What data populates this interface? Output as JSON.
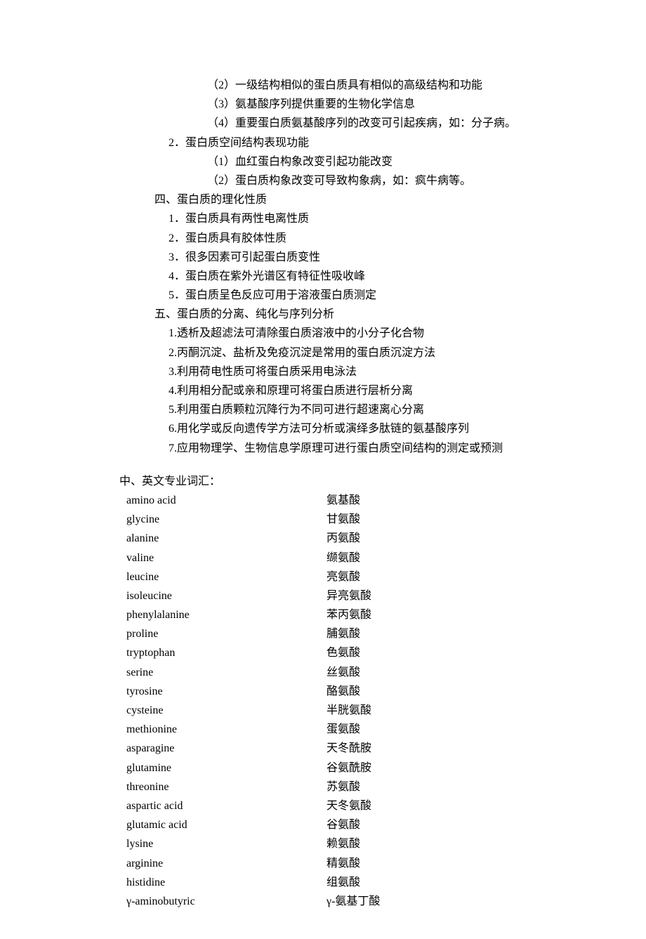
{
  "outline": {
    "l3_items": [
      "（2）一级结构相似的蛋白质具有相似的高级结构和功能",
      "（3）氨基酸序列提供重要的生物化学信息",
      "（4）重要蛋白质氨基酸序列的改变可引起疾病，如：分子病。"
    ],
    "sec2_title": "2．蛋白质空间结构表现功能",
    "sec2_items": [
      "（1）血红蛋白构象改变引起功能改变",
      "（2）蛋白质构象改变可导致构象病，如：疯牛病等。"
    ],
    "section4_title": "四、蛋白质的理化性质",
    "section4_items": [
      "1．蛋白质具有两性电离性质",
      "2．蛋白质具有胶体性质",
      "3．很多因素可引起蛋白质变性",
      "4．蛋白质在紫外光谱区有特征性吸收峰",
      "5．蛋白质呈色反应可用于溶液蛋白质测定"
    ],
    "section5_title": "五、蛋白质的分离、纯化与序列分析",
    "section5_items": [
      "1.透析及超滤法可清除蛋白质溶液中的小分子化合物",
      "2.丙酮沉淀、盐析及免疫沉淀是常用的蛋白质沉淀方法",
      "3.利用荷电性质可将蛋白质采用电泳法",
      "4.利用相分配或亲和原理可将蛋白质进行层析分离",
      "5.利用蛋白质颗粒沉降行为不同可进行超速离心分离",
      "6.用化学或反向遗传学方法可分析或演绎多肽链的氨基酸序列",
      "7.应用物理学、生物信息学原理可进行蛋白质空间结构的测定或预测"
    ]
  },
  "vocab_heading": "中、英文专业词汇：",
  "vocab": [
    {
      "en": "amino acid",
      "cn": "氨基酸"
    },
    {
      "en": "glycine",
      "cn": "甘氨酸"
    },
    {
      "en": "alanine",
      "cn": "丙氨酸"
    },
    {
      "en": "valine",
      "cn": "缬氨酸"
    },
    {
      "en": "leucine",
      "cn": "亮氨酸"
    },
    {
      "en": "isoleucine",
      "cn": "异亮氨酸"
    },
    {
      "en": "phenylalanine",
      "cn": "苯丙氨酸"
    },
    {
      "en": "proline",
      "cn": "脯氨酸"
    },
    {
      "en": "tryptophan",
      "cn": "色氨酸"
    },
    {
      "en": "serine",
      "cn": "丝氨酸"
    },
    {
      "en": "tyrosine",
      "cn": "酪氨酸"
    },
    {
      "en": "cysteine",
      "cn": "半胱氨酸"
    },
    {
      "en": "methionine",
      "cn": "蛋氨酸"
    },
    {
      "en": "asparagine",
      "cn": "天冬酰胺"
    },
    {
      "en": "glutamine",
      "cn": "谷氨酰胺"
    },
    {
      "en": "threonine",
      "cn": "苏氨酸"
    },
    {
      "en": "aspartic acid",
      "cn": "天冬氨酸"
    },
    {
      "en": "glutamic acid",
      "cn": "谷氨酸"
    },
    {
      "en": "lysine",
      "cn": "赖氨酸"
    },
    {
      "en": "arginine",
      "cn": "精氨酸"
    },
    {
      "en": "histidine",
      "cn": "组氨酸"
    },
    {
      "en": "γ-aminobutyric",
      "cn": "γ-氨基丁酸"
    }
  ]
}
